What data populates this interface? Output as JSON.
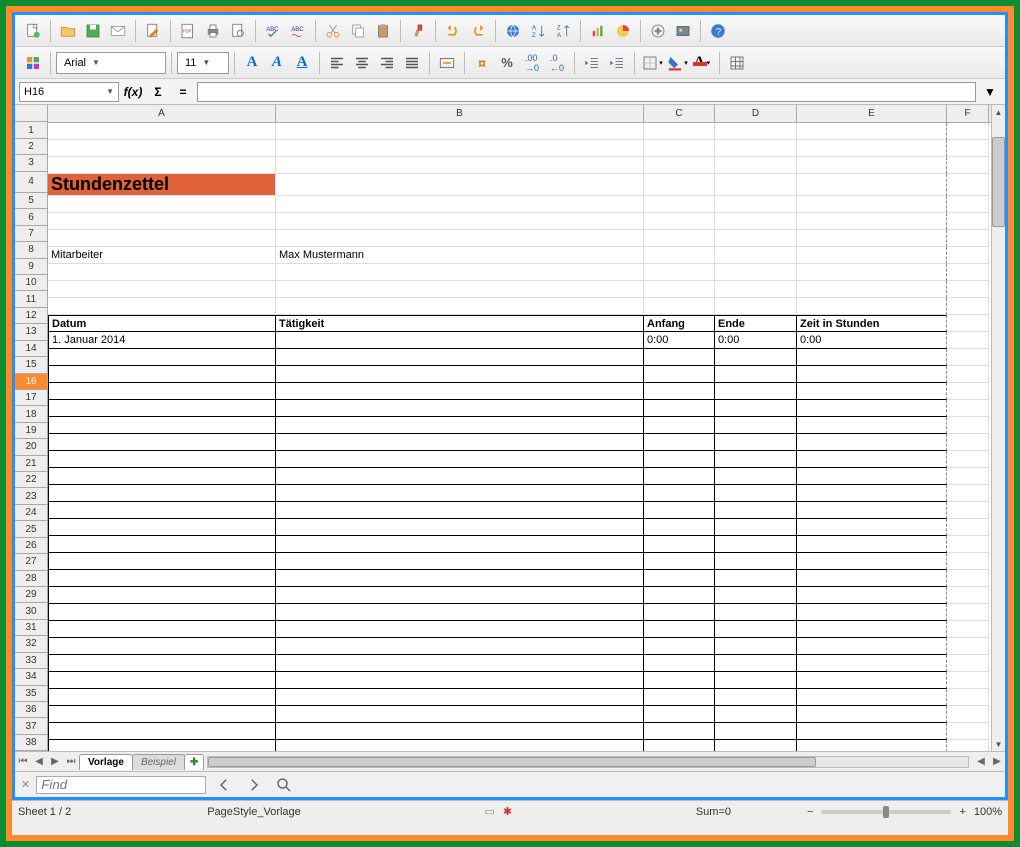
{
  "toolbar2": {
    "font_name": "Arial",
    "font_size": "11"
  },
  "formula_bar": {
    "cell_ref": "H16",
    "fx_label": "f(x)",
    "sum_label": "Σ",
    "eq_label": "="
  },
  "columns": [
    "A",
    "B",
    "C",
    "D",
    "E",
    "F"
  ],
  "rows_before_table": [
    1,
    2,
    3,
    4,
    5,
    6,
    7,
    8,
    9,
    10,
    11
  ],
  "table_header_row": 12,
  "table_rows": [
    13,
    14,
    15,
    16,
    17,
    18,
    19,
    20,
    21,
    22,
    23,
    24,
    25,
    26,
    27,
    28,
    29,
    30,
    31,
    32,
    33,
    34,
    35,
    36,
    37,
    38
  ],
  "selected_row": 16,
  "content": {
    "title": "Stundenzettel",
    "label_employee": "Mitarbeiter",
    "employee_name": "Max Mustermann",
    "col_date": "Datum",
    "col_activity": "Tätigkeit",
    "col_start": "Anfang",
    "col_end": "Ende",
    "col_hours": "Zeit in Stunden",
    "first_date": "1. Januar 2014",
    "first_start": "0:00",
    "first_end": "0:00",
    "first_hours": "0:00"
  },
  "sheet_tabs": {
    "tab1": "Vorlage",
    "tab2": "Beispiel"
  },
  "find_bar": {
    "placeholder": "Find"
  },
  "status_bar": {
    "sheet_pos": "Sheet 1 / 2",
    "page_style": "PageStyle_Vorlage",
    "sum": "Sum=0",
    "zoom": "100%"
  }
}
